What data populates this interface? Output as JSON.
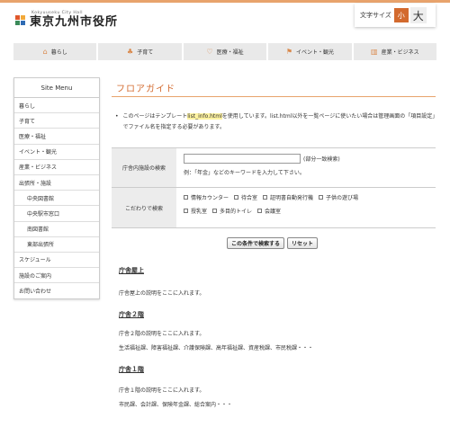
{
  "header": {
    "logo_sub": "Kokyuuseku City Hall",
    "logo_title": "東京九州市役所",
    "fontsize_label": "文字サイズ",
    "fontsize_small": "小",
    "fontsize_large": "大"
  },
  "gnav": [
    {
      "label": "暮らし",
      "icon": "house-icon",
      "glyph": "⌂"
    },
    {
      "label": "子育て",
      "icon": "stroller-icon",
      "glyph": "♣"
    },
    {
      "label": "医療・福祉",
      "icon": "stethoscope-icon",
      "glyph": "♡"
    },
    {
      "label": "イベント・観光",
      "icon": "flag-icon",
      "glyph": "⚑"
    },
    {
      "label": "産業・ビジネス",
      "icon": "building-icon",
      "glyph": "▥"
    }
  ],
  "sidemenu": {
    "title": "Site Menu",
    "items": [
      {
        "label": "暮らし",
        "sub": false
      },
      {
        "label": "子育て",
        "sub": false
      },
      {
        "label": "医療・福祉",
        "sub": false
      },
      {
        "label": "イベント・観光",
        "sub": false
      },
      {
        "label": "産業・ビジネス",
        "sub": false
      },
      {
        "label": "出張所・施設",
        "sub": false
      },
      {
        "label": "中央図書館",
        "sub": true
      },
      {
        "label": "中央駅市窓口",
        "sub": true
      },
      {
        "label": "南図書館",
        "sub": true
      },
      {
        "label": "東部出張所",
        "sub": true
      },
      {
        "label": "スケジュール",
        "sub": false
      },
      {
        "label": "施設のご案内",
        "sub": false
      },
      {
        "label": "お問い合わせ",
        "sub": false
      }
    ]
  },
  "main": {
    "title": "フロアガイド",
    "notice_1": "このページはテンプレート",
    "notice_link": "list_info.html",
    "notice_2": "を使用しています。list.html以外を一覧ページに使いたい場合は管理画面の「項目設定」でファイル名を指定する必要があります。",
    "search": {
      "keyword_label": "庁舎内施設の検索",
      "keyword_value": "",
      "keyword_suffix": "(部分一致検索)",
      "keyword_note": "例：「年金」などのキーワードを入力して下さい。",
      "filter_label": "こだわりで検索",
      "checkboxes": [
        "情報カウンター",
        "待合室",
        "証明書自動発行機",
        "子供の遊び場",
        "授乳室",
        "多目的トイレ",
        "会議室"
      ],
      "submit_label": "この条件で検索する",
      "reset_label": "リセット"
    },
    "sections": [
      {
        "title": "庁舎屋上",
        "lines": [
          "庁舎屋上の説明をここに入れます。"
        ]
      },
      {
        "title": "庁舎２階",
        "lines": [
          "庁舎２階の説明をここに入れます。",
          "生活福祉課、障害福祉課、介護保険課、高年福祉課、資産税課、市民税課・・・"
        ]
      },
      {
        "title": "庁舎１階",
        "lines": [
          "庁舎１階の説明をここに入れます。",
          "市民課、会計課、保険年金課、総合案内・・・"
        ]
      }
    ]
  }
}
